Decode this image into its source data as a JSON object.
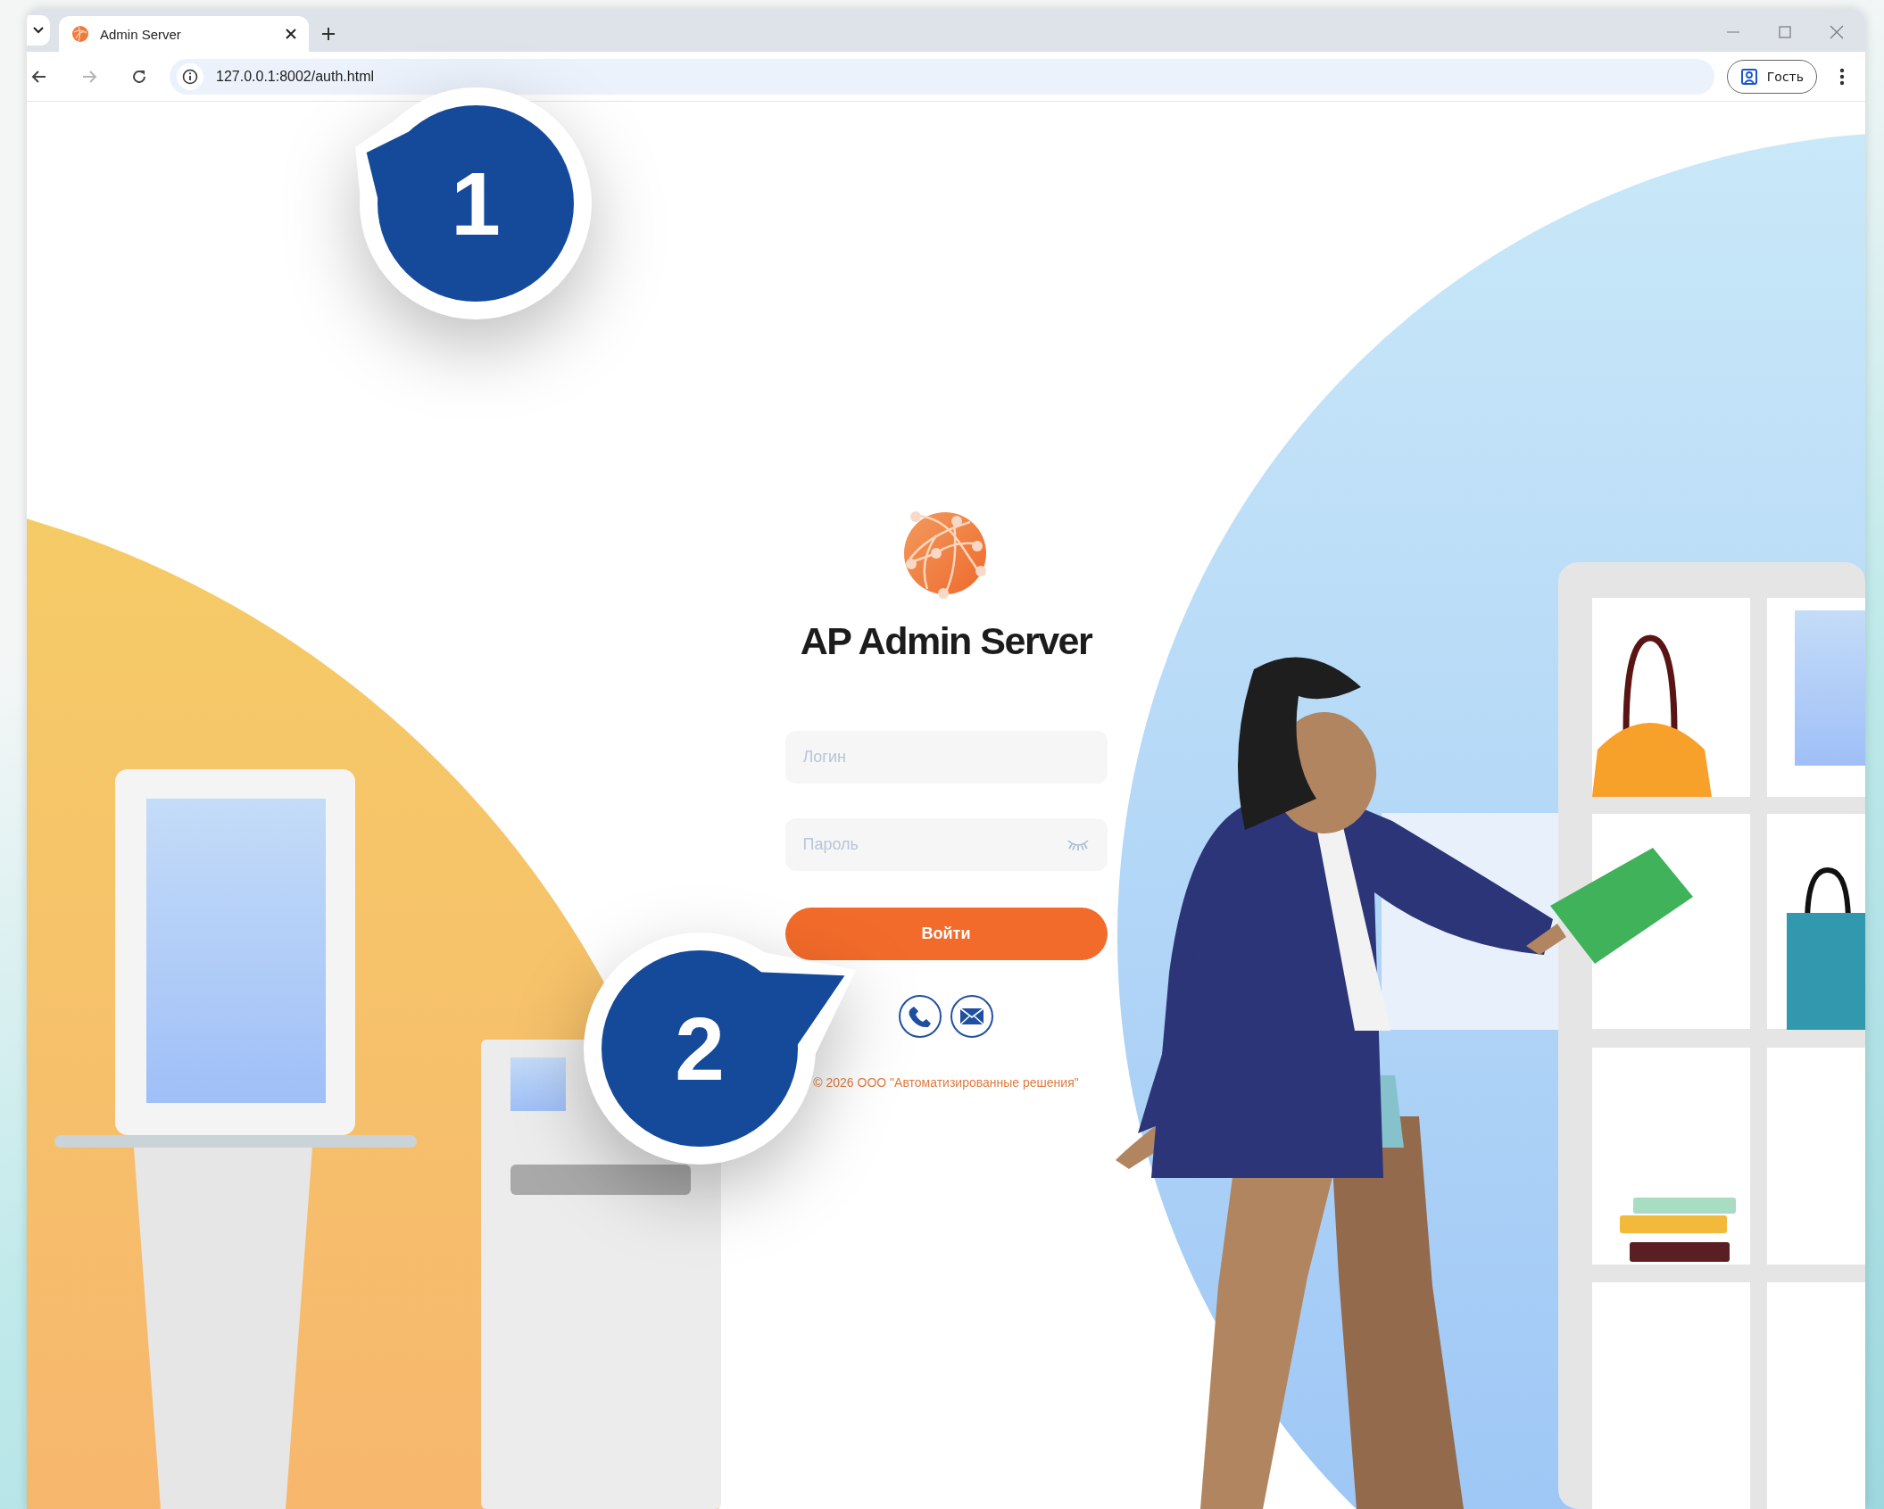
{
  "browser": {
    "tabs": [
      {
        "title": "Admin Server",
        "selected": true
      }
    ],
    "address": "127.0.0.1:8002/auth.html",
    "back_disabled": false,
    "forward_disabled": true,
    "profile": "Гость"
  },
  "login": {
    "title": "AP Admin Server",
    "fields": [
      {
        "kind": "text",
        "placeholder": "Логин"
      },
      {
        "kind": "password",
        "placeholder": "Пароль"
      }
    ],
    "submit": "Войти",
    "contacts": [
      {
        "kind": "phone"
      },
      {
        "kind": "email"
      }
    ],
    "copyright": "© 2026 ООО \"Автоматизированные решения\""
  },
  "callouts": [
    {
      "number": "1"
    },
    {
      "number": "2"
    }
  ]
}
